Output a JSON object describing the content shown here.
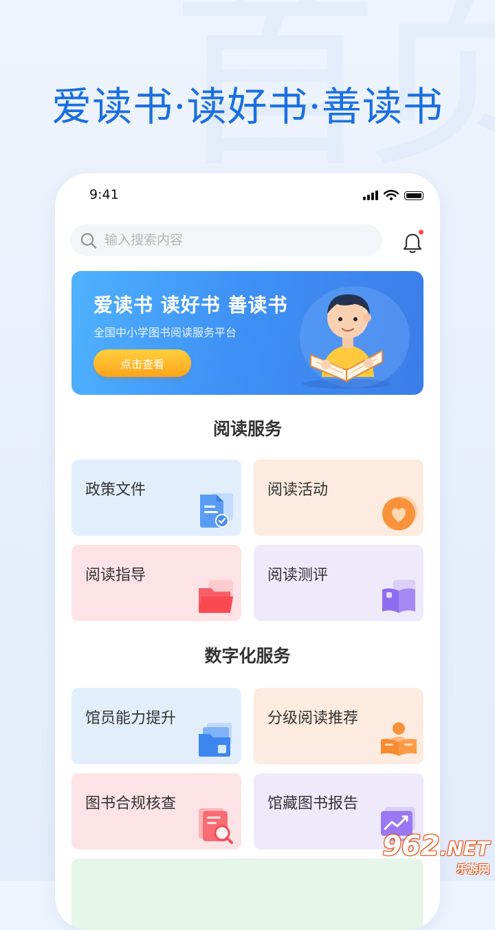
{
  "background_char": "首页",
  "headline": "爱读书·读好书·善读书",
  "status_bar": {
    "time": "9:41"
  },
  "search": {
    "placeholder": "输入搜索内容"
  },
  "banner": {
    "title": "爱读书 读好书 善读书",
    "subtitle": "全国中小学图书阅读服务平台",
    "button_label": "点击查看"
  },
  "sections": [
    {
      "title": "阅读服务",
      "cards": [
        {
          "label": "政策文件",
          "icon": "document-check-icon",
          "color": "#e3eefd"
        },
        {
          "label": "阅读活动",
          "icon": "heart-badge-icon",
          "color": "#fdebdf"
        },
        {
          "label": "阅读指导",
          "icon": "folder-icon",
          "color": "#fde3e6"
        },
        {
          "label": "阅读测评",
          "icon": "open-book-icon",
          "color": "#eeeafc"
        }
      ]
    },
    {
      "title": "数字化服务",
      "cards": [
        {
          "label": "馆员能力提升",
          "icon": "folder-stack-icon",
          "color": "#e3eefd"
        },
        {
          "label": "分级阅读推荐",
          "icon": "reader-person-icon",
          "color": "#fdebdf"
        },
        {
          "label": "图书合规核查",
          "icon": "search-file-icon",
          "color": "#fde3e6"
        },
        {
          "label": "馆藏图书报告",
          "icon": "trend-chart-icon",
          "color": "#eeeafc"
        }
      ]
    }
  ],
  "watermark": {
    "main": "962",
    "domain": ".NET",
    "sub": "乐游网"
  },
  "colors": {
    "accent": "#1a6fe0",
    "banner_blue": "#3f92f5",
    "button_orange": "#ffa41b"
  }
}
